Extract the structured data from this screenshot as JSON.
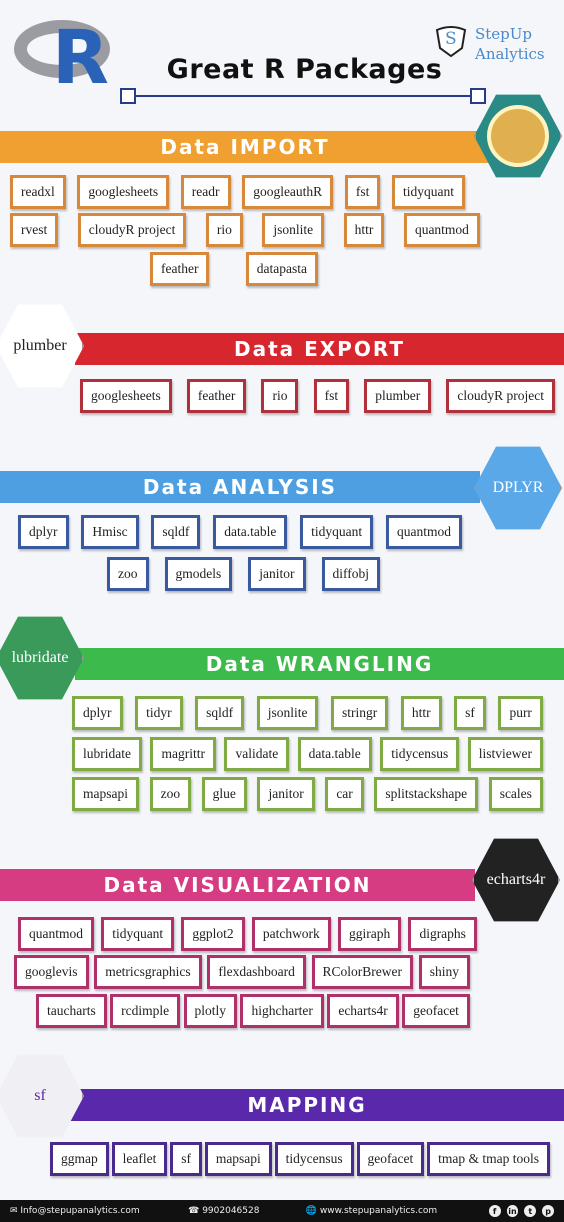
{
  "header": {
    "title": "Great R Packages",
    "brand_line1": "StepUp",
    "brand_line2": "Analytics",
    "brand_initial": "S",
    "r_logo_letter": "R"
  },
  "sections": [
    {
      "title": "Data IMPORT",
      "color": "#f0a030",
      "border": "#d8883a",
      "logo": "",
      "rows": [
        [
          "readxl",
          "googlesheets",
          "readr",
          "googleauthR",
          "fst",
          "tidyquant"
        ],
        [
          "rvest",
          "cloudyR project",
          "rio",
          "jsonlite",
          "httr",
          "quantmod"
        ],
        [
          "feather",
          "datapasta"
        ]
      ]
    },
    {
      "title": "Data EXPORT",
      "color": "#d8262e",
      "border": "#b0303c",
      "logo": "plumber",
      "rows": [
        [
          "googlesheets",
          "feather",
          "rio",
          "fst",
          "plumber",
          "cloudyR project"
        ]
      ]
    },
    {
      "title": "Data ANALYSIS",
      "color": "#4e9fe2",
      "border": "#3a5aa0",
      "logo": "DPLYR",
      "rows": [
        [
          "dplyr",
          "Hmisc",
          "sqldf",
          "data.table",
          "tidyquant",
          "quantmod"
        ],
        [
          "zoo",
          "gmodels",
          "janitor",
          "diffobj"
        ]
      ]
    },
    {
      "title": "Data WRANGLING",
      "color": "#3cba4c",
      "border": "#80aa44",
      "logo": "lubridate",
      "rows": [
        [
          "dplyr",
          "tidyr",
          "sqldf",
          "jsonlite",
          "stringr",
          "httr",
          "sf",
          "purr"
        ],
        [
          "lubridate",
          "magrittr",
          "validate",
          "data.table",
          "tidycensus",
          "listviewer"
        ],
        [
          "mapsapi",
          "zoo",
          "glue",
          "janitor",
          "car",
          "splitstackshape",
          "scales"
        ]
      ]
    },
    {
      "title": "Data VISUALIZATION",
      "color": "#d63c82",
      "border": "#b0306a",
      "logo": "echarts4r",
      "rows": [
        [
          "quantmod",
          "tidyquant",
          "ggplot2",
          "patchwork",
          "ggiraph",
          "digraphs"
        ],
        [
          "googlevis",
          "metricsgraphics",
          "flexdashboard",
          "RColorBrewer",
          "shiny"
        ],
        [
          "taucharts",
          "rcdimple",
          "plotly",
          "highcharter",
          "echarts4r",
          "geofacet"
        ]
      ]
    },
    {
      "title": "MAPPING",
      "color": "#5a28aa",
      "border": "#4a2a8a",
      "logo": "sf",
      "rows": [
        [
          "ggmap",
          "leaflet",
          "sf",
          "mapsapi",
          "tidycensus",
          "geofacet",
          "tmap & tmap tools"
        ]
      ]
    }
  ],
  "footer": {
    "email": "Info@stepupanalytics.com",
    "phone": "9902046528",
    "website": "www.stepupanalytics.com",
    "social": [
      "f",
      "in",
      "t",
      "p"
    ]
  }
}
